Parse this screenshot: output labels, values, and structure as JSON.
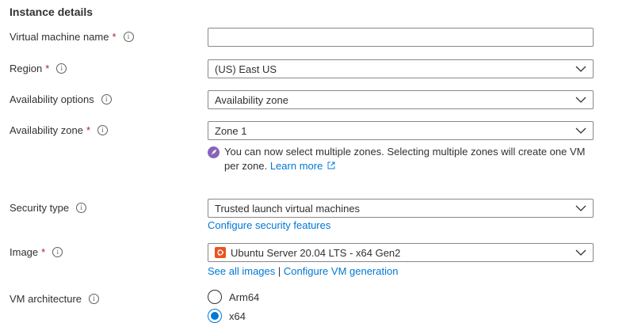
{
  "section": {
    "title": "Instance details"
  },
  "fields": {
    "vm_name": {
      "label": "Virtual machine name",
      "required": "*",
      "value": ""
    },
    "region": {
      "label": "Region",
      "required": "*",
      "value": "(US) East US"
    },
    "availability_options": {
      "label": "Availability options",
      "value": "Availability zone"
    },
    "availability_zone": {
      "label": "Availability zone",
      "required": "*",
      "value": "Zone 1",
      "note": "You can now select multiple zones. Selecting multiple zones will create one VM per zone.",
      "note_link": "Learn more"
    },
    "security_type": {
      "label": "Security type",
      "value": "Trusted launch virtual machines",
      "link": "Configure security features"
    },
    "image": {
      "label": "Image",
      "required": "*",
      "value": "Ubuntu Server 20.04 LTS - x64 Gen2",
      "link1": "See all images",
      "separator": "|",
      "link2": "Configure VM generation"
    },
    "vm_architecture": {
      "label": "VM architecture",
      "options": [
        {
          "label": "Arm64",
          "selected": false
        },
        {
          "label": "x64",
          "selected": true
        }
      ]
    }
  },
  "icons": {
    "info": "info-icon",
    "chevron": "chevron-down-icon",
    "rocket": "rocket-icon",
    "ubuntu": "ubuntu-icon",
    "external": "external-link-icon"
  },
  "colors": {
    "link": "#0078d4",
    "required": "#a4262c",
    "rocket_bg": "#8764b8",
    "ubuntu": "#e95420"
  }
}
